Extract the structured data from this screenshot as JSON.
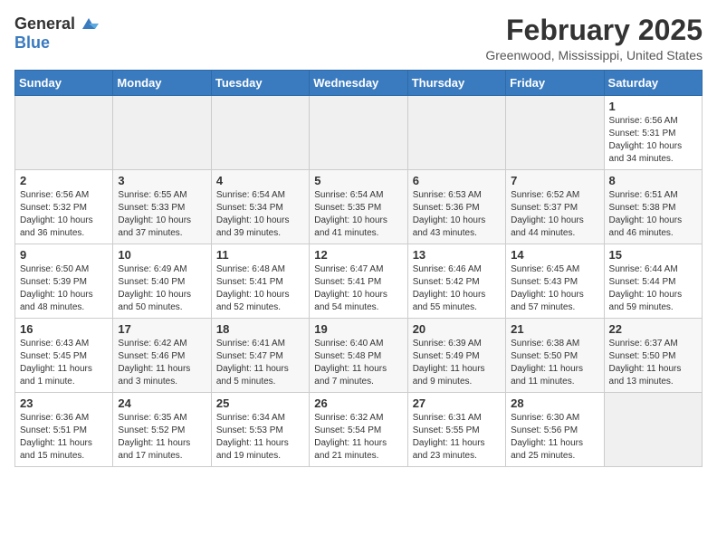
{
  "logo": {
    "general": "General",
    "blue": "Blue"
  },
  "title": "February 2025",
  "location": "Greenwood, Mississippi, United States",
  "weekdays": [
    "Sunday",
    "Monday",
    "Tuesday",
    "Wednesday",
    "Thursday",
    "Friday",
    "Saturday"
  ],
  "weeks": [
    [
      {
        "day": "",
        "info": ""
      },
      {
        "day": "",
        "info": ""
      },
      {
        "day": "",
        "info": ""
      },
      {
        "day": "",
        "info": ""
      },
      {
        "day": "",
        "info": ""
      },
      {
        "day": "",
        "info": ""
      },
      {
        "day": "1",
        "info": "Sunrise: 6:56 AM\nSunset: 5:31 PM\nDaylight: 10 hours\nand 34 minutes."
      }
    ],
    [
      {
        "day": "2",
        "info": "Sunrise: 6:56 AM\nSunset: 5:32 PM\nDaylight: 10 hours\nand 36 minutes."
      },
      {
        "day": "3",
        "info": "Sunrise: 6:55 AM\nSunset: 5:33 PM\nDaylight: 10 hours\nand 37 minutes."
      },
      {
        "day": "4",
        "info": "Sunrise: 6:54 AM\nSunset: 5:34 PM\nDaylight: 10 hours\nand 39 minutes."
      },
      {
        "day": "5",
        "info": "Sunrise: 6:54 AM\nSunset: 5:35 PM\nDaylight: 10 hours\nand 41 minutes."
      },
      {
        "day": "6",
        "info": "Sunrise: 6:53 AM\nSunset: 5:36 PM\nDaylight: 10 hours\nand 43 minutes."
      },
      {
        "day": "7",
        "info": "Sunrise: 6:52 AM\nSunset: 5:37 PM\nDaylight: 10 hours\nand 44 minutes."
      },
      {
        "day": "8",
        "info": "Sunrise: 6:51 AM\nSunset: 5:38 PM\nDaylight: 10 hours\nand 46 minutes."
      }
    ],
    [
      {
        "day": "9",
        "info": "Sunrise: 6:50 AM\nSunset: 5:39 PM\nDaylight: 10 hours\nand 48 minutes."
      },
      {
        "day": "10",
        "info": "Sunrise: 6:49 AM\nSunset: 5:40 PM\nDaylight: 10 hours\nand 50 minutes."
      },
      {
        "day": "11",
        "info": "Sunrise: 6:48 AM\nSunset: 5:41 PM\nDaylight: 10 hours\nand 52 minutes."
      },
      {
        "day": "12",
        "info": "Sunrise: 6:47 AM\nSunset: 5:41 PM\nDaylight: 10 hours\nand 54 minutes."
      },
      {
        "day": "13",
        "info": "Sunrise: 6:46 AM\nSunset: 5:42 PM\nDaylight: 10 hours\nand 55 minutes."
      },
      {
        "day": "14",
        "info": "Sunrise: 6:45 AM\nSunset: 5:43 PM\nDaylight: 10 hours\nand 57 minutes."
      },
      {
        "day": "15",
        "info": "Sunrise: 6:44 AM\nSunset: 5:44 PM\nDaylight: 10 hours\nand 59 minutes."
      }
    ],
    [
      {
        "day": "16",
        "info": "Sunrise: 6:43 AM\nSunset: 5:45 PM\nDaylight: 11 hours\nand 1 minute."
      },
      {
        "day": "17",
        "info": "Sunrise: 6:42 AM\nSunset: 5:46 PM\nDaylight: 11 hours\nand 3 minutes."
      },
      {
        "day": "18",
        "info": "Sunrise: 6:41 AM\nSunset: 5:47 PM\nDaylight: 11 hours\nand 5 minutes."
      },
      {
        "day": "19",
        "info": "Sunrise: 6:40 AM\nSunset: 5:48 PM\nDaylight: 11 hours\nand 7 minutes."
      },
      {
        "day": "20",
        "info": "Sunrise: 6:39 AM\nSunset: 5:49 PM\nDaylight: 11 hours\nand 9 minutes."
      },
      {
        "day": "21",
        "info": "Sunrise: 6:38 AM\nSunset: 5:50 PM\nDaylight: 11 hours\nand 11 minutes."
      },
      {
        "day": "22",
        "info": "Sunrise: 6:37 AM\nSunset: 5:50 PM\nDaylight: 11 hours\nand 13 minutes."
      }
    ],
    [
      {
        "day": "23",
        "info": "Sunrise: 6:36 AM\nSunset: 5:51 PM\nDaylight: 11 hours\nand 15 minutes."
      },
      {
        "day": "24",
        "info": "Sunrise: 6:35 AM\nSunset: 5:52 PM\nDaylight: 11 hours\nand 17 minutes."
      },
      {
        "day": "25",
        "info": "Sunrise: 6:34 AM\nSunset: 5:53 PM\nDaylight: 11 hours\nand 19 minutes."
      },
      {
        "day": "26",
        "info": "Sunrise: 6:32 AM\nSunset: 5:54 PM\nDaylight: 11 hours\nand 21 minutes."
      },
      {
        "day": "27",
        "info": "Sunrise: 6:31 AM\nSunset: 5:55 PM\nDaylight: 11 hours\nand 23 minutes."
      },
      {
        "day": "28",
        "info": "Sunrise: 6:30 AM\nSunset: 5:56 PM\nDaylight: 11 hours\nand 25 minutes."
      },
      {
        "day": "",
        "info": ""
      }
    ]
  ]
}
